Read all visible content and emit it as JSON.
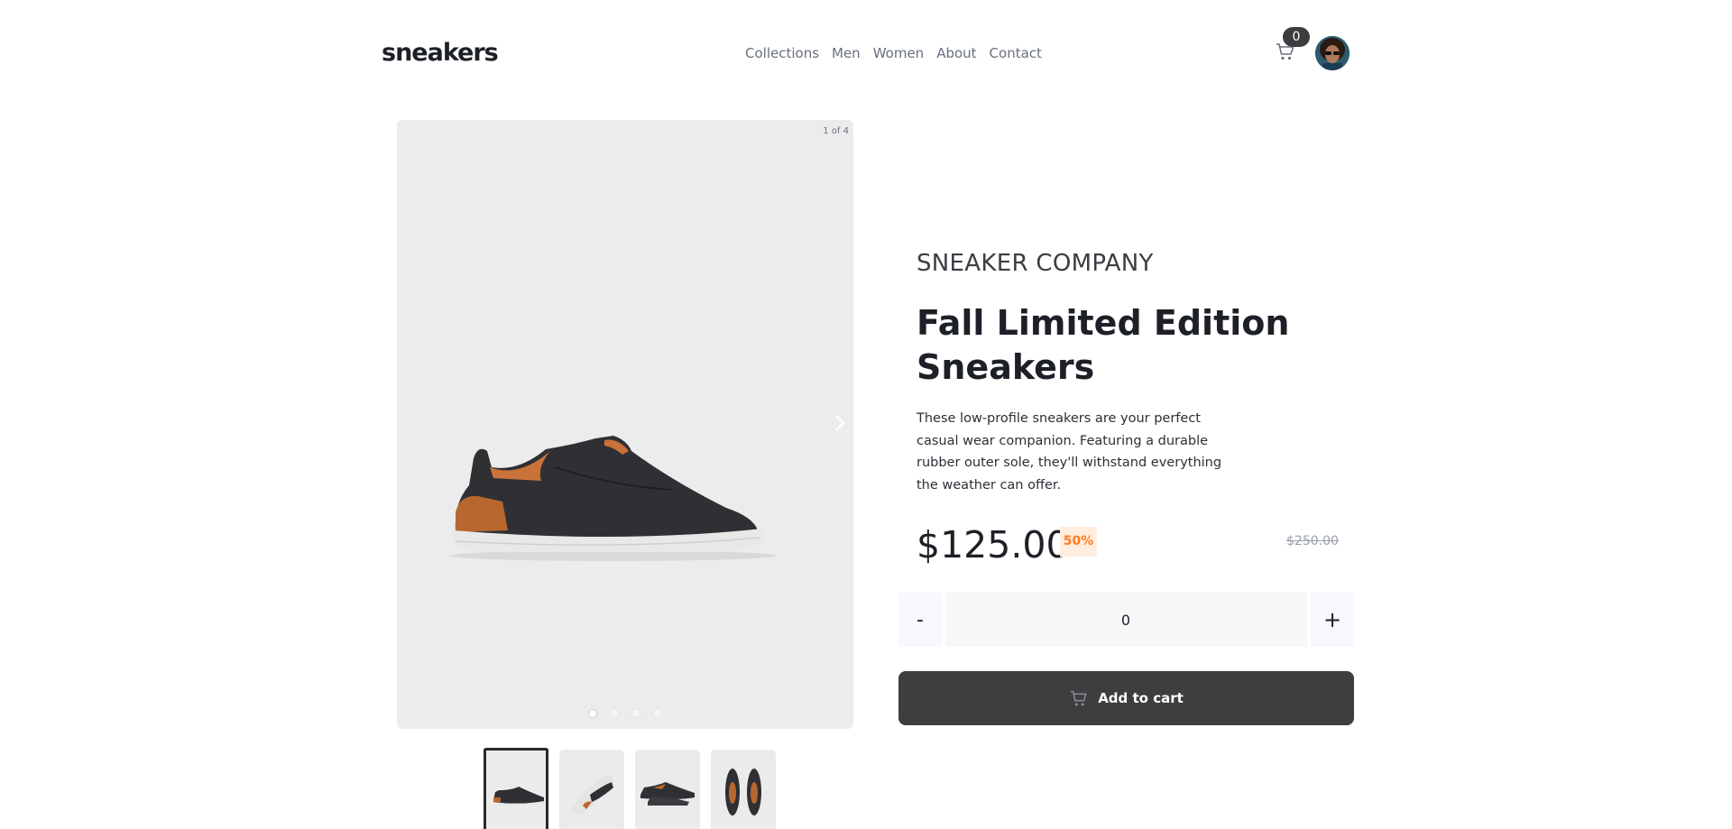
{
  "header": {
    "logo": "sneakers",
    "nav": [
      "Collections",
      "Men",
      "Women",
      "About",
      "Contact"
    ],
    "cart_count": "0"
  },
  "gallery": {
    "counter": "1 of 4",
    "slide_count": 4,
    "active_slide": 0
  },
  "product": {
    "company": "SNEAKER COMPANY",
    "title": "Fall Limited Edition Sneakers",
    "description": "These low-profile sneakers are your perfect casual wear companion. Featuring a durable rubber outer sole, they'll withstand everything the weather can offer.",
    "price": "$125.00",
    "discount": "50%",
    "old_price": "$250.00"
  },
  "quantity": {
    "minus_label": "-",
    "value": "0",
    "plus_label": "+"
  },
  "cta": {
    "add_to_cart": "Add to cart"
  },
  "colors": {
    "accent": "#ff7d1a",
    "dark_button": "#3f3d40",
    "badge": "#3d3d3f"
  }
}
